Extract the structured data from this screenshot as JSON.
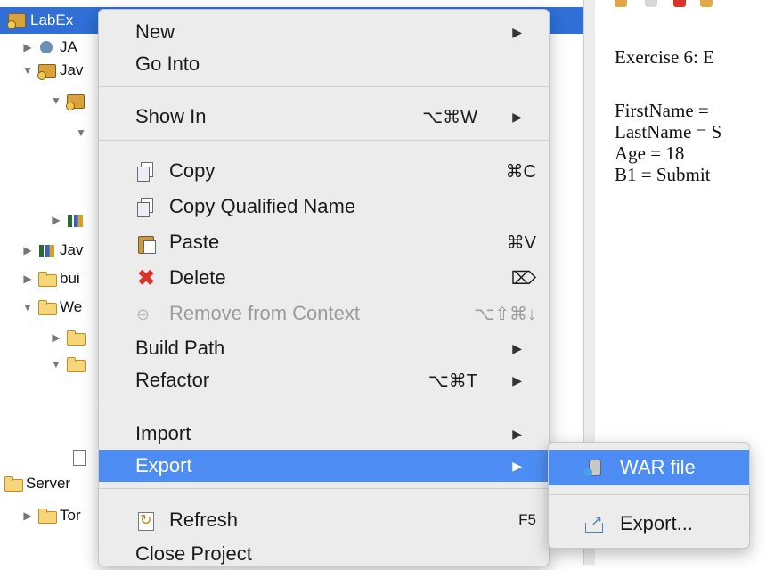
{
  "tree": {
    "selected_label": "LabEx",
    "rows": [
      {
        "arrow": "▶",
        "icon": "jax",
        "label": "JA"
      },
      {
        "arrow": "▼",
        "icon": "proj",
        "label": "Jav"
      },
      {
        "arrow": "▼",
        "icon": "proj",
        "label": ""
      },
      {
        "arrow": "▼",
        "icon": "",
        "label": ""
      },
      {
        "arrow": "▶",
        "icon": "lib",
        "label": ""
      },
      {
        "arrow": "▶",
        "icon": "lib",
        "label": "Jav"
      },
      {
        "arrow": "▶",
        "icon": "folder",
        "label": "bui"
      },
      {
        "arrow": "▼",
        "icon": "folder",
        "label": "We"
      },
      {
        "arrow": "▶",
        "icon": "folder",
        "label": ""
      },
      {
        "arrow": "▼",
        "icon": "folder",
        "label": ""
      },
      {
        "arrow": "",
        "icon": "doc",
        "label": ""
      },
      {
        "arrow": "",
        "icon": "folder",
        "label": "Server"
      },
      {
        "arrow": "▶",
        "icon": "folder",
        "label": "Tor"
      }
    ]
  },
  "output": {
    "heading": "Exercise 6: E",
    "lines": [
      "FirstName = ",
      "LastName = S",
      "Age = 18",
      "B1 = Submit"
    ]
  },
  "menu": {
    "new": {
      "label": "New",
      "sub": "▶"
    },
    "go_into": {
      "label": "Go Into"
    },
    "show_in": {
      "label": "Show In",
      "shortcut": "⌥⌘W",
      "sub": "▶"
    },
    "copy": {
      "label": "Copy",
      "shortcut": "⌘C"
    },
    "copy_qualified": {
      "label": "Copy Qualified Name"
    },
    "paste": {
      "label": "Paste",
      "shortcut": "⌘V"
    },
    "delete": {
      "label": "Delete",
      "shortcut": "⌦"
    },
    "remove_context": {
      "label": "Remove from Context",
      "shortcut": "⌥⇧⌘↓"
    },
    "build_path": {
      "label": "Build Path",
      "sub": "▶"
    },
    "refactor": {
      "label": "Refactor",
      "shortcut": "⌥⌘T",
      "sub": "▶"
    },
    "import": {
      "label": "Import",
      "sub": "▶"
    },
    "export": {
      "label": "Export",
      "sub": "▶"
    },
    "refresh": {
      "label": "Refresh",
      "shortcut": "F5"
    },
    "close_project": {
      "label": "Close Project"
    }
  },
  "submenu": {
    "war_file": "WAR file",
    "export": "Export..."
  },
  "colors": {
    "highlight": "#4d8df3",
    "selection": "#2f6fd6"
  }
}
